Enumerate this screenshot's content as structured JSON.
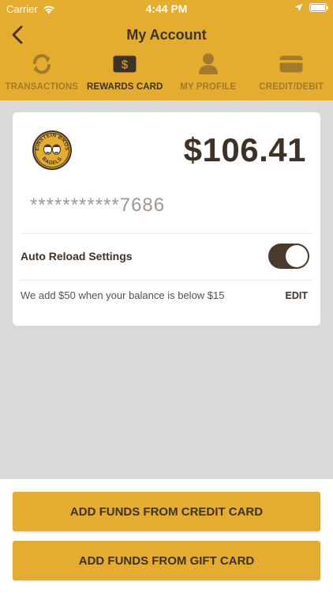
{
  "status_bar": {
    "carrier": "Carrier",
    "time": "4:44 PM"
  },
  "nav": {
    "title": "My Account"
  },
  "tabs": [
    {
      "label": "TRANSACTIONS",
      "icon": "refresh-icon",
      "active": false
    },
    {
      "label": "REWARDS CARD",
      "icon": "dollar-card-icon",
      "active": true
    },
    {
      "label": "MY PROFILE",
      "icon": "person-icon",
      "active": false
    },
    {
      "label": "CREDIT/DEBIT",
      "icon": "credit-card-icon",
      "active": false
    }
  ],
  "card": {
    "balance": "$106.41",
    "masked_number": "***********7686",
    "auto_reload_label": "Auto Reload Settings",
    "auto_reload_enabled": true,
    "reload_description": "We add $50 when your balance is below $15",
    "edit_label": "EDIT"
  },
  "actions": {
    "credit_card_label": "ADD FUNDS FROM CREDIT CARD",
    "gift_card_label": "ADD FUNDS FROM GIFT CARD"
  },
  "colors": {
    "brand_yellow": "#e5ad2f",
    "dark_brown": "#3e3226",
    "muted_tab": "#a27a2a"
  }
}
